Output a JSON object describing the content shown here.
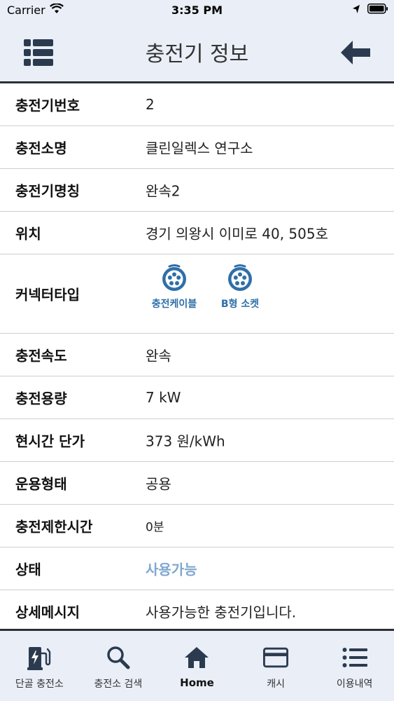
{
  "status_bar": {
    "carrier": "Carrier",
    "time": "3:35 PM"
  },
  "nav": {
    "title": "충전기 정보"
  },
  "rows": [
    {
      "label": "충전기번호",
      "value": "2"
    },
    {
      "label": "충전소명",
      "value": "클린일렉스 연구소"
    },
    {
      "label": "충전기명칭",
      "value": "완속2"
    },
    {
      "label": "위치",
      "value": "경기 의왕시 이미로 40, 505호"
    },
    {
      "label": "커넥터타입",
      "connectors": [
        "충전케이블",
        "B형 소켓"
      ]
    },
    {
      "label": "충전속도",
      "value": "완속"
    },
    {
      "label": "충전용량",
      "value": "7 kW"
    },
    {
      "label": "현시간 단가",
      "value": "373 원/kWh"
    },
    {
      "label": "운용형태",
      "value": "공용"
    },
    {
      "label": "충전제한시간",
      "value": "0분"
    },
    {
      "label": "상태",
      "value": "사용가능"
    },
    {
      "label": "상세메시지",
      "value": "사용가능한 충전기입니다."
    }
  ],
  "tabs": [
    {
      "label": "단골 충전소",
      "icon": "ev-charger-icon"
    },
    {
      "label": "충전소 검색",
      "icon": "search-icon"
    },
    {
      "label": "Home",
      "icon": "home-icon"
    },
    {
      "label": "캐시",
      "icon": "card-icon"
    },
    {
      "label": "이용내역",
      "icon": "list-icon"
    }
  ],
  "colors": {
    "bar_bg": "#e9eef7",
    "accent": "#2f6fa8",
    "status_available": "#7fa7d0",
    "divider": "#2b2f36"
  }
}
